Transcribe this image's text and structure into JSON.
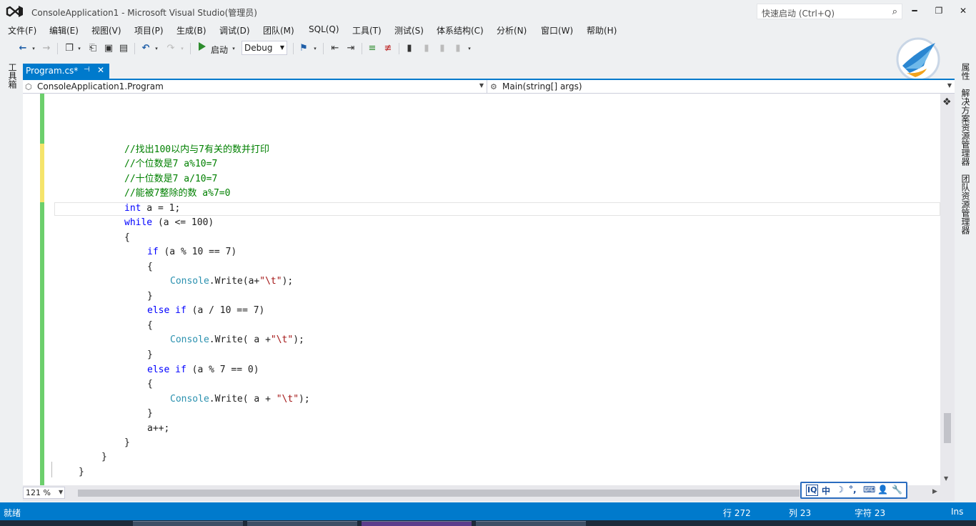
{
  "window": {
    "title": "ConsoleApplication1 - Microsoft Visual Studio(管理员)",
    "quick_launch_placeholder": "快速启动 (Ctrl+Q)",
    "minimize": "━",
    "restore": "❐",
    "close": "✕"
  },
  "menu": [
    "文件(F)",
    "编辑(E)",
    "视图(V)",
    "项目(P)",
    "生成(B)",
    "调试(D)",
    "团队(M)",
    "SQL(Q)",
    "工具(T)",
    "测试(S)",
    "体系结构(C)",
    "分析(N)",
    "窗口(W)",
    "帮助(H)"
  ],
  "toolbar": {
    "start_label": "启动",
    "config": "Debug"
  },
  "side_tabs": {
    "toolbox": "工具箱",
    "properties": "属性",
    "solution_explorer": "解决方案资源管理器",
    "team_explorer": "团队资源管理器"
  },
  "document_tab": {
    "label": "Program.cs*",
    "pin": "⊣",
    "close": "✕"
  },
  "navigation": {
    "class": "ConsoleApplication1.Program",
    "member": "Main(string[] args)"
  },
  "code": {
    "comment1": "//找出100以内与7有关的数并打印",
    "comment2": "//个位数是7 a%10=7",
    "comment3": "//十位数是7 a/10=7",
    "comment4": "//能被7整除的数 a%7=0",
    "kw_int": "int",
    "decl_rest": " a = 1;",
    "kw_while": "while",
    "while_rest": " (a <= 100)",
    "open_brace": "{",
    "close_brace": "}",
    "kw_if": "if",
    "if1_rest": " (a % 10 == 7)",
    "kw_else_if": "else if",
    "if2_rest": " (a / 10 == 7)",
    "if3_rest": " (a % 7 == 0)",
    "type_console": "Console",
    "write1_rest": ".Write(a+",
    "write2_rest": ".Write( a +",
    "write3_rest": ".Write( a + ",
    "tab_string": "\"\\t\"",
    "stmt_end": ");",
    "increment": "a++;"
  },
  "editor": {
    "zoom": "121 %"
  },
  "ime": [
    "中",
    "☽",
    "°,",
    "⌨",
    "👤",
    "🔧"
  ],
  "ime_logo": "IQ",
  "status": {
    "ready": "就绪",
    "line": "行 272",
    "col": "列 23",
    "char": "字符 23",
    "mode": "Ins"
  }
}
